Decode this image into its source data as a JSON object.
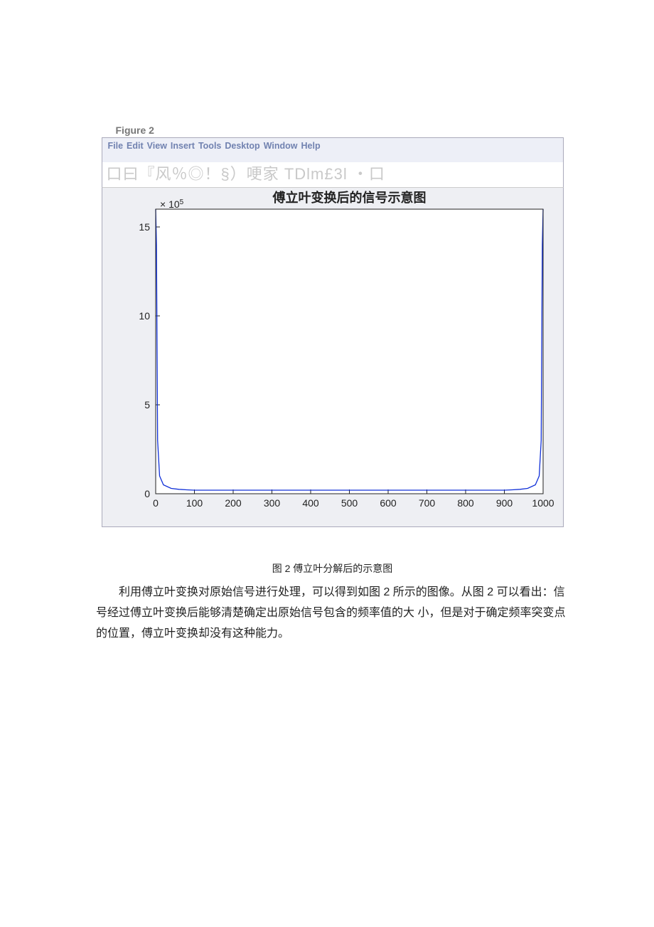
{
  "window": {
    "title": "Figure 2",
    "menu": {
      "file": "File",
      "edit": "Edit",
      "view": "View",
      "insert": "Insert",
      "tools": "Tools",
      "desktop": "Desktop",
      "window": "Window",
      "help": "Help"
    },
    "toolbar_garbled": "口曰『风％◎！§）哽家 TDlm£3l ・口"
  },
  "chart_data": {
    "type": "line",
    "title": "傅立叶变换后的信号示意图",
    "y_exponent_label": "× 10",
    "y_exponent_sup": "5",
    "xlim": [
      0,
      1000
    ],
    "ylim": [
      0,
      16
    ],
    "xticks": [
      0,
      100,
      200,
      300,
      400,
      500,
      600,
      700,
      800,
      900,
      1000
    ],
    "yticks": [
      0,
      5,
      10,
      15
    ],
    "x": [
      0,
      2,
      5,
      10,
      20,
      40,
      60,
      80,
      100,
      150,
      200,
      300,
      400,
      500,
      600,
      700,
      800,
      850,
      900,
      920,
      940,
      960,
      980,
      990,
      995,
      998,
      1000
    ],
    "values": [
      16,
      14,
      3,
      1.0,
      0.5,
      0.3,
      0.25,
      0.22,
      0.2,
      0.2,
      0.2,
      0.2,
      0.2,
      0.2,
      0.2,
      0.2,
      0.2,
      0.2,
      0.2,
      0.22,
      0.25,
      0.3,
      0.5,
      1.0,
      3,
      14,
      16
    ],
    "xlabel": "",
    "ylabel": ""
  },
  "document": {
    "caption": "图 2 傅立叶分解后的示意图",
    "paragraph": "利用傅立叶变换对原始信号进行处理，可以得到如图 2 所示的图像。从图 2 可以看出：信号经过傅立叶变换后能够清楚确定出原始信号包含的频率值的大 小，但是对于确定频率突变点的位置，傅立叶变换却没有这种能力。"
  }
}
